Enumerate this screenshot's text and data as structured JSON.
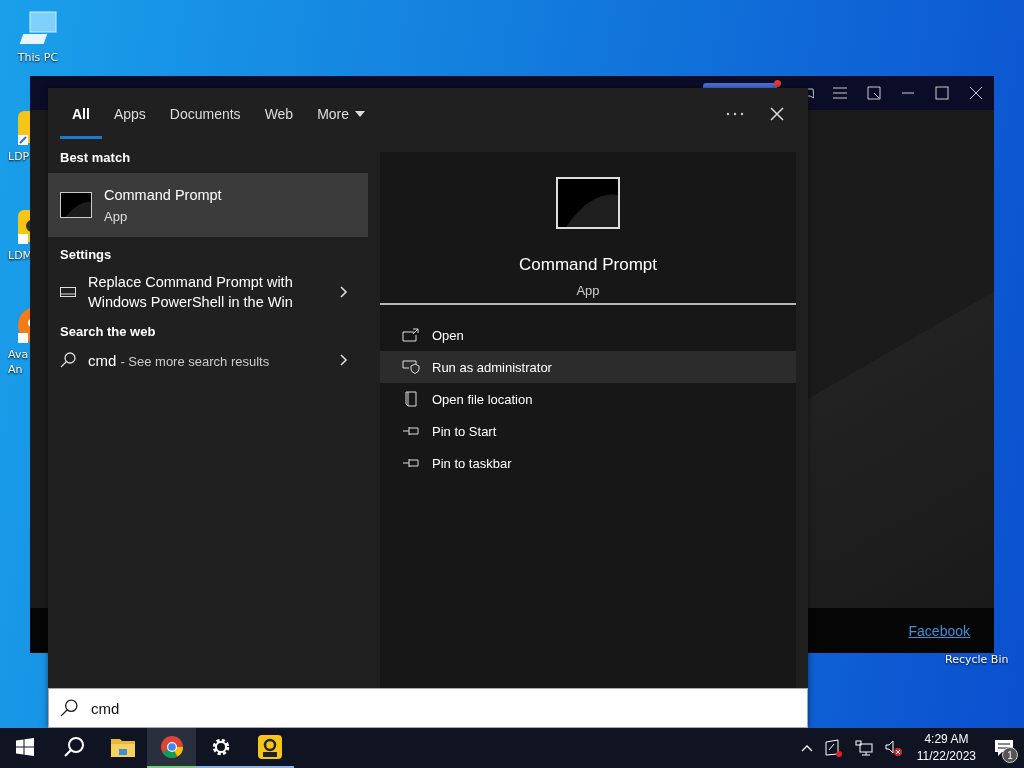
{
  "desktop_icons": [
    {
      "kind": "pc",
      "lines": [
        "This PC"
      ]
    },
    {
      "kind": "ldplayer",
      "lines": [
        "LDP"
      ]
    },
    {
      "kind": "ldmulti",
      "lines": [
        "LDM"
      ]
    },
    {
      "kind": "avatar",
      "lines": [
        "Ava",
        "An"
      ]
    }
  ],
  "recycle_bin": {
    "label": "Recycle Bin"
  },
  "background_window": {
    "link": "Facebook"
  },
  "search_panel": {
    "tabs": [
      {
        "label": "All",
        "selected": true,
        "has_menu": false
      },
      {
        "label": "Apps",
        "selected": false,
        "has_menu": false
      },
      {
        "label": "Documents",
        "selected": false,
        "has_menu": false
      },
      {
        "label": "Web",
        "selected": false,
        "has_menu": false
      },
      {
        "label": "More",
        "selected": false,
        "has_menu": true
      }
    ],
    "sections": [
      {
        "heading": "Best match",
        "items": [
          {
            "kind": "app",
            "title": "Command Prompt",
            "subtitle": "App",
            "selected": true
          }
        ]
      },
      {
        "heading": "Settings",
        "items": [
          {
            "kind": "setting",
            "title": "Replace Command Prompt with Windows PowerShell in the Win",
            "selected": false
          }
        ]
      },
      {
        "heading": "Search the web",
        "items": [
          {
            "kind": "web",
            "title": "cmd",
            "subtitle": "- See more search results",
            "selected": false
          }
        ]
      }
    ],
    "preview": {
      "title": "Command Prompt",
      "subtitle": "App"
    },
    "actions": [
      {
        "kind": "open",
        "label": "Open",
        "selected": false
      },
      {
        "kind": "admin",
        "label": "Run as administrator",
        "selected": true
      },
      {
        "kind": "folder",
        "label": "Open file location",
        "selected": false
      },
      {
        "kind": "pin",
        "label": "Pin to Start",
        "selected": false
      },
      {
        "kind": "pin",
        "label": "Pin to taskbar",
        "selected": false
      }
    ],
    "search_field": {
      "value": "cmd"
    }
  },
  "taskbar": {
    "apps": [
      {
        "kind": "start",
        "running": false,
        "selected": false
      },
      {
        "kind": "search",
        "running": false,
        "selected": false
      },
      {
        "kind": "explorer",
        "running": false,
        "selected": false
      },
      {
        "kind": "chrome",
        "running": true,
        "selected": true
      },
      {
        "kind": "settings",
        "running": true,
        "selected": false
      },
      {
        "kind": "ldplayer",
        "running": true,
        "selected": false
      }
    ],
    "clock": {
      "time": "4:29 AM",
      "date": "11/22/2023"
    },
    "notification_count": "1"
  }
}
